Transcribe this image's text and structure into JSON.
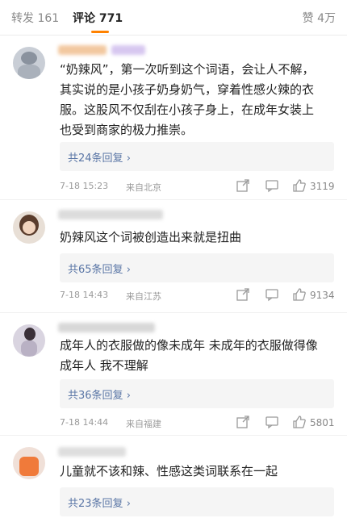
{
  "tabs": {
    "repost_label": "转发",
    "repost_count": "161",
    "comment_label": "评论",
    "comment_count": "771",
    "like_label": "赞",
    "like_count": "4万"
  },
  "colors": {
    "accent": "#ff8200",
    "link": "#5a76a6",
    "reply_box_bg": "#f5f5f5"
  },
  "comments": [
    {
      "text_lines": [
        "“奶辣风”，第一次听到这个词语，会让人不解，",
        "其实说的是小孩子奶身奶气，穿着性感火辣的衣",
        "服。这股风不仅刮在小孩子身上，在成年女装上",
        "也受到商家的极力推崇。"
      ],
      "replies": "共24条回复",
      "date": "7-18 15:23",
      "location": "来自北京",
      "likes": "3119"
    },
    {
      "text_lines": [
        "奶辣风这个词被创造出来就是扭曲"
      ],
      "replies": "共65条回复",
      "date": "7-18 14:43",
      "location": "来自江苏",
      "likes": "9134"
    },
    {
      "text_lines": [
        "成年人的衣服做的像未成年 未成年的衣服做得像",
        "成年人 我不理解"
      ],
      "replies": "共36条回复",
      "date": "7-18 14:44",
      "location": "来自福建",
      "likes": "5801"
    },
    {
      "text_lines": [
        "儿童就不该和辣、性感这类词联系在一起"
      ],
      "replies": "共23条回复"
    }
  ],
  "icons": {
    "share": "share-icon",
    "reply": "reply-icon",
    "like": "thumbs-up-icon",
    "more": "chevron-right-icon"
  }
}
